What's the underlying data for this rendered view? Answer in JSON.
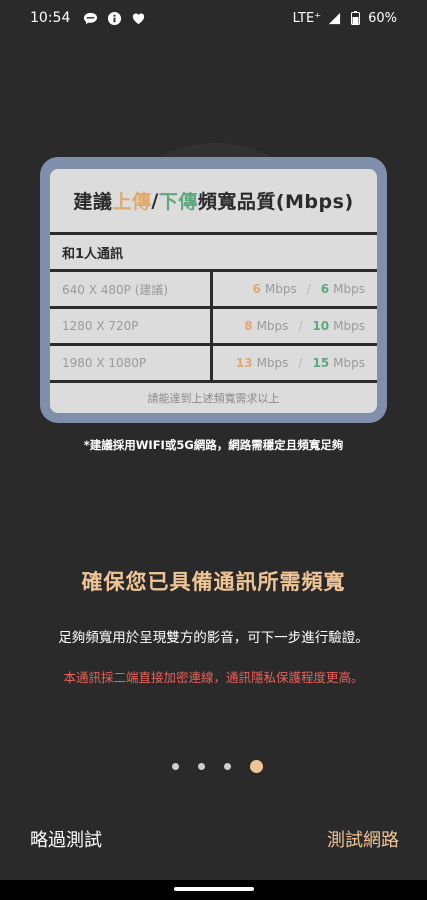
{
  "status_bar": {
    "time": "10:54",
    "network": "LTE⁺",
    "battery": "60%",
    "icons": [
      "chat-icon",
      "info-icon",
      "heart-icon",
      "signal-icon",
      "battery-icon"
    ]
  },
  "card": {
    "title_prefix": "建議 ",
    "title_upload": "上傳",
    "title_slash": " / ",
    "title_download": "下傳",
    "title_suffix": " 頻寬品質(Mbps)",
    "subheader": "和1人通訊",
    "rows": [
      {
        "resolution": "640 X 480P (建議)",
        "up": "6",
        "up_unit": "Mbps",
        "sep": "/",
        "down": "6",
        "down_unit": "Mbps"
      },
      {
        "resolution": "1280 X 720P",
        "up": "8",
        "up_unit": "Mbps",
        "sep": "/",
        "down": "10",
        "down_unit": "Mbps"
      },
      {
        "resolution": "1980 X 1080P",
        "up": "13",
        "up_unit": "Mbps",
        "sep": "/",
        "down": "15",
        "down_unit": "Mbps"
      }
    ],
    "footer": "請能達到上述頻寬需求以上"
  },
  "note": "*建議採用WIFI或5G網路，網路需穩定且頻寬足夠",
  "headline": "確保您已具備通訊所需頻寬",
  "description": "足夠頻寬用於呈現雙方的影音，可下一步進行驗證。",
  "warning": "本通訊採二端直接加密連線，通訊隱私保護程度更高。",
  "pager": {
    "total": 4,
    "current": 4
  },
  "buttons": {
    "skip": "略過測試",
    "next": "測試網路"
  },
  "colors": {
    "accent": "#f0c596",
    "upload": "#e0a96c",
    "download": "#5fa87d",
    "warning": "#e6625b"
  }
}
